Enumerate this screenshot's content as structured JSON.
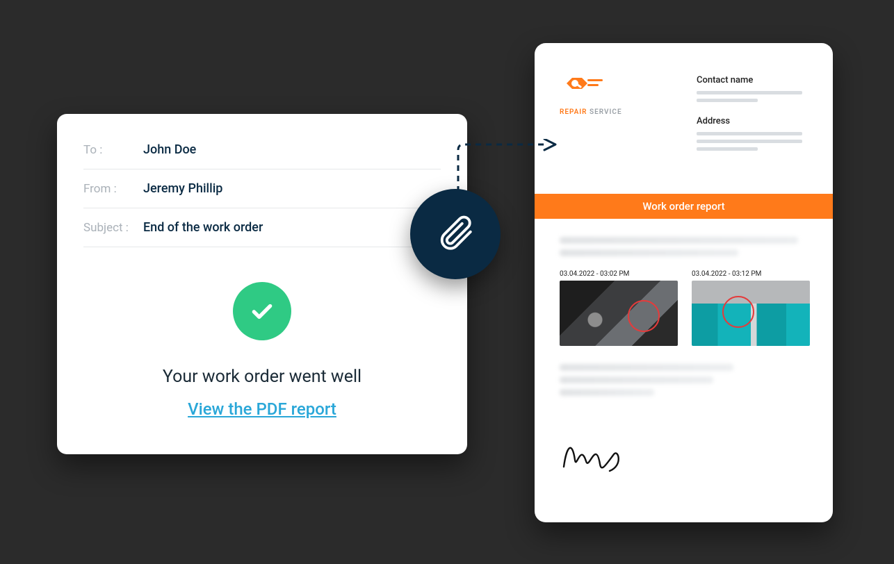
{
  "email": {
    "to_label": "To :",
    "to_value": "John Doe",
    "from_label": "From :",
    "from_value": "Jeremy Phillip",
    "subject_label": "Subject :",
    "subject_value": "End of the work order",
    "status_text": "Your work order went well",
    "pdf_link_text": "View the PDF report"
  },
  "report": {
    "logo_text_1": "REPAIR",
    "logo_text_2": "SERVICE",
    "contact_name_label": "Contact name",
    "address_label": "Address",
    "band_title": "Work order report",
    "photo1_ts": "03.04.2022 - 03:02 PM",
    "photo2_ts": "03.04.2022 - 03:12 PM"
  },
  "colors": {
    "accent_orange": "#ff7a1a",
    "badge_navy": "#0a2a43",
    "check_green": "#2fca84",
    "link_blue": "#2aa7d8"
  }
}
